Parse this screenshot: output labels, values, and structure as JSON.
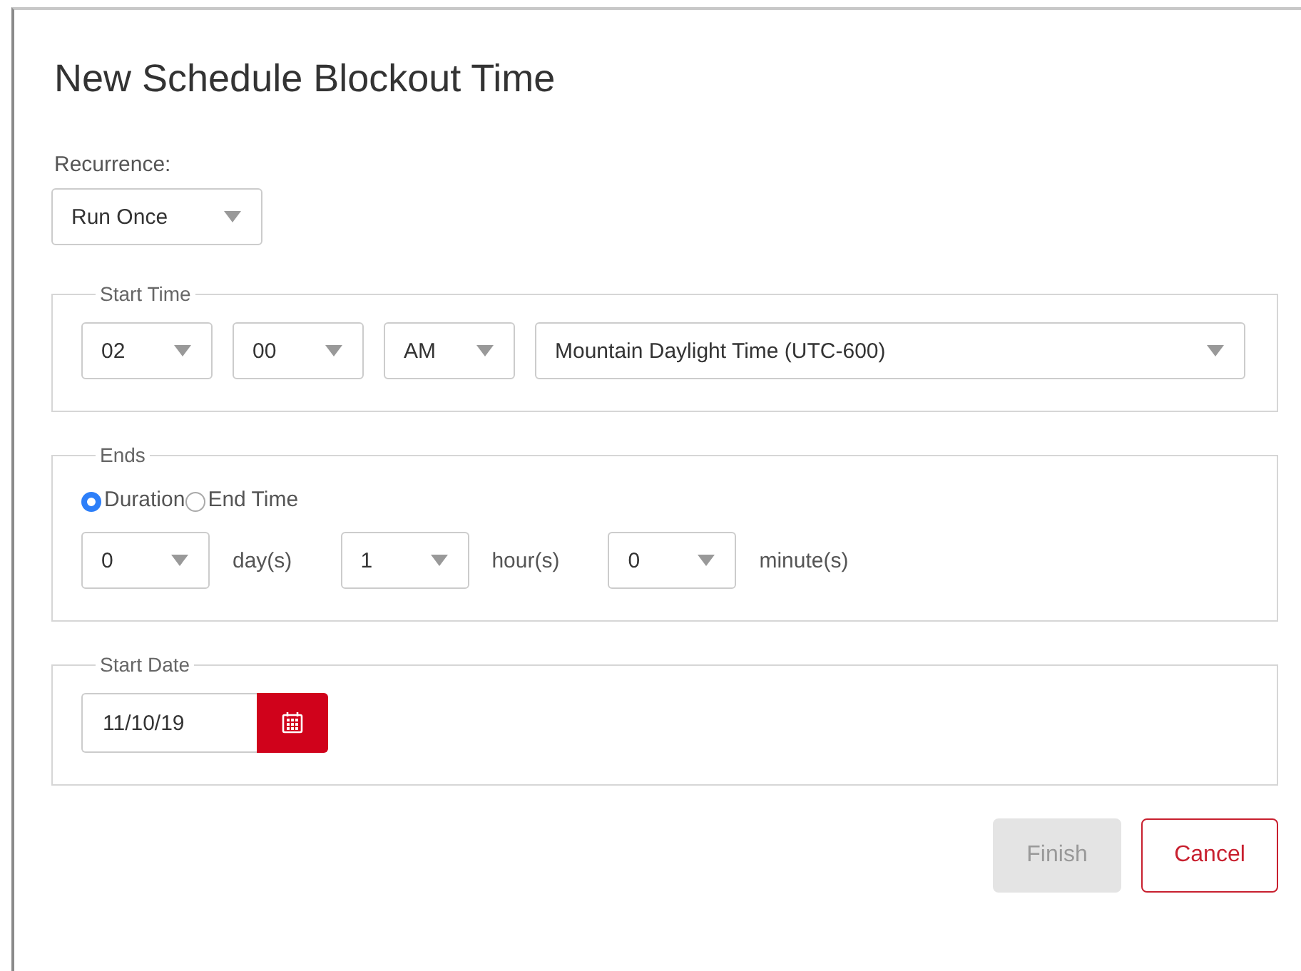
{
  "dialog": {
    "title": "New Schedule Blockout Time"
  },
  "recurrence": {
    "label": "Recurrence:",
    "value": "Run Once"
  },
  "start_time": {
    "legend": "Start Time",
    "hour": "02",
    "minute": "00",
    "period": "AM",
    "timezone": "Mountain Daylight Time (UTC-600)"
  },
  "ends": {
    "legend": "Ends",
    "options": [
      {
        "label": "Duration",
        "selected": true
      },
      {
        "label": "End Time",
        "selected": false
      }
    ],
    "duration": [
      {
        "value": "0",
        "unit": "day(s)"
      },
      {
        "value": "1",
        "unit": "hour(s)"
      },
      {
        "value": "0",
        "unit": "minute(s)"
      }
    ]
  },
  "start_date": {
    "legend": "Start Date",
    "value": "11/10/19"
  },
  "buttons": [
    {
      "label": "Finish",
      "kind": "primary",
      "disabled": true
    },
    {
      "label": "Cancel",
      "kind": "secondary",
      "disabled": false
    }
  ]
}
